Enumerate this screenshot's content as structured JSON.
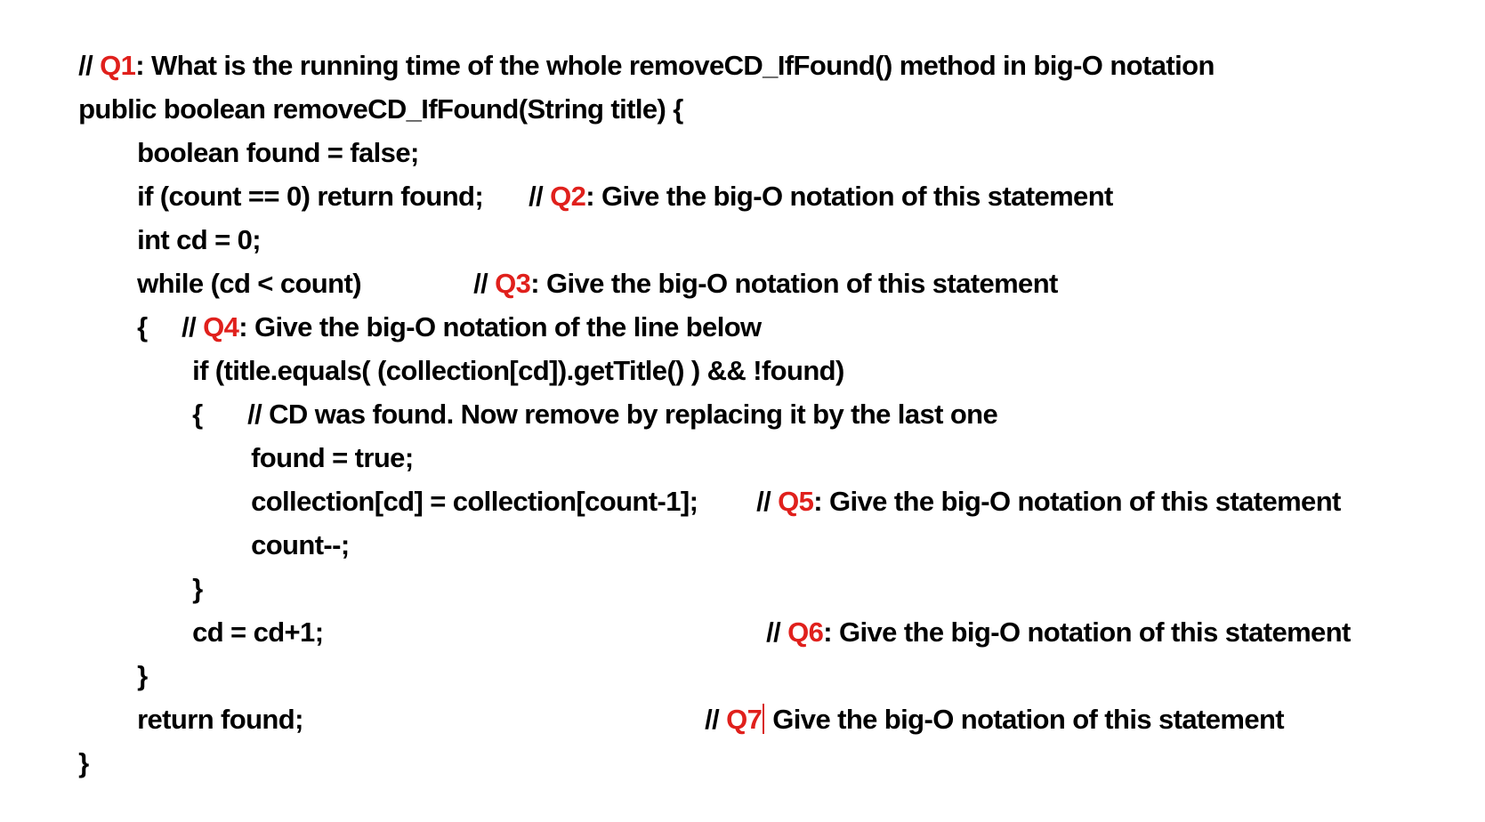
{
  "document": {
    "colors": {
      "text": "#000000",
      "question_label": "#e0201c",
      "background": "#ffffff"
    },
    "lines": [
      {
        "code": "",
        "comment": {
          "prefix": "// ",
          "q": "Q1",
          "text": ": What is the running time of the whole removeCD_IfFound() method in big-O notation"
        }
      },
      {
        "code": "public boolean removeCD_IfFound(String title) {"
      },
      {
        "code": "boolean found = false;"
      },
      {
        "code": "if (count == 0) return found;",
        "comment": {
          "prefix": "// ",
          "q": "Q2",
          "text": ": Give the big-O notation of this statement"
        }
      },
      {
        "code": "int cd = 0;"
      },
      {
        "code": "while (cd < count)",
        "comment": {
          "prefix": "// ",
          "q": "Q3",
          "text": ": Give the big-O notation of this statement"
        }
      },
      {
        "code": "{",
        "comment": {
          "prefix": "// ",
          "q": "Q4",
          "text": ": Give the big-O notation of the line below"
        }
      },
      {
        "code": "if (title.equals( (collection[cd]).getTitle() ) && !found)"
      },
      {
        "code": "{",
        "comment": {
          "text": "// CD was found. Now remove by replacing it by the last one"
        }
      },
      {
        "code": "found = true;"
      },
      {
        "code": "collection[cd] = collection[count-1];",
        "comment": {
          "prefix": "// ",
          "q": "Q5",
          "text": ": Give the big-O notation of this statement"
        }
      },
      {
        "code": "count--;"
      },
      {
        "code": "}"
      },
      {
        "code": "cd = cd+1;",
        "comment": {
          "prefix": "// ",
          "q": "Q6",
          "text": ": Give the big-O notation of this statement"
        }
      },
      {
        "code": "}"
      },
      {
        "code": "return found;",
        "comment": {
          "prefix": "// ",
          "q": "Q7",
          "text": " Give the big-O notation of this statement"
        }
      },
      {
        "code": "}"
      }
    ]
  }
}
